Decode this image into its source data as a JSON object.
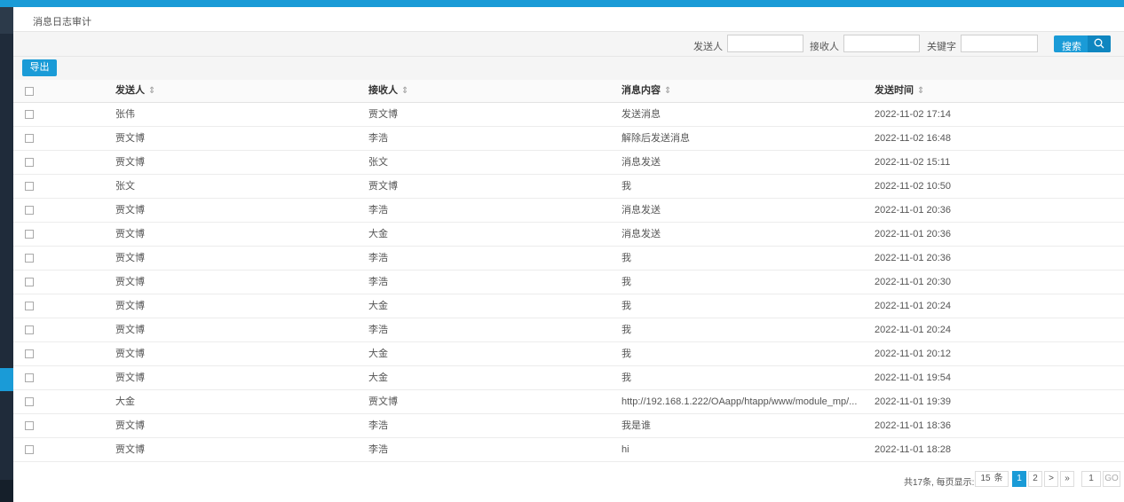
{
  "page": {
    "title": "消息日志审计"
  },
  "search": {
    "sender_label": "发送人",
    "sender_value": "",
    "receiver_label": "接收人",
    "receiver_value": "",
    "keyword_label": "关键字",
    "keyword_value": "",
    "button_label": "搜索"
  },
  "toolbar": {
    "export_label": "导出"
  },
  "table": {
    "columns": [
      "发送人",
      "接收人",
      "消息内容",
      "发送时间"
    ],
    "sort_indicator": "⇕",
    "rows": [
      {
        "sender": "张伟",
        "receiver": "贾文博",
        "content": "发送消息",
        "time": "2022-11-02 17:14"
      },
      {
        "sender": "贾文博",
        "receiver": "李浩",
        "content": "解除后发送消息",
        "time": "2022-11-02 16:48"
      },
      {
        "sender": "贾文博",
        "receiver": "张文",
        "content": "消息发送",
        "time": "2022-11-02 15:11"
      },
      {
        "sender": "张文",
        "receiver": "贾文博",
        "content": "我",
        "time": "2022-11-02 10:50"
      },
      {
        "sender": "贾文博",
        "receiver": "李浩",
        "content": "消息发送",
        "time": "2022-11-01 20:36"
      },
      {
        "sender": "贾文博",
        "receiver": "大金",
        "content": "消息发送",
        "time": "2022-11-01 20:36"
      },
      {
        "sender": "贾文博",
        "receiver": "李浩",
        "content": "我",
        "time": "2022-11-01 20:36"
      },
      {
        "sender": "贾文博",
        "receiver": "李浩",
        "content": "我",
        "time": "2022-11-01 20:30"
      },
      {
        "sender": "贾文博",
        "receiver": "大金",
        "content": "我",
        "time": "2022-11-01 20:24"
      },
      {
        "sender": "贾文博",
        "receiver": "李浩",
        "content": "我",
        "time": "2022-11-01 20:24"
      },
      {
        "sender": "贾文博",
        "receiver": "大金",
        "content": "我",
        "time": "2022-11-01 20:12"
      },
      {
        "sender": "贾文博",
        "receiver": "大金",
        "content": "我",
        "time": "2022-11-01 19:54"
      },
      {
        "sender": "大金",
        "receiver": "贾文博",
        "content": "http://192.168.1.222/OAapp/htapp/www/module_mp/...",
        "time": "2022-11-01 19:39"
      },
      {
        "sender": "贾文博",
        "receiver": "李浩",
        "content": "我是谁",
        "time": "2022-11-01 18:36"
      },
      {
        "sender": "贾文博",
        "receiver": "李浩",
        "content": "hi",
        "time": "2022-11-01 18:28"
      }
    ]
  },
  "pager": {
    "summary": "共17条, 每页显示:",
    "page_size": "15",
    "page_size_unit": "条",
    "pages": [
      "1",
      "2"
    ],
    "current_page": 1,
    "next_label": ">",
    "last_label": "»",
    "jump_value": "1",
    "go_label": "GO"
  },
  "colors": {
    "accent": "#1a9bd7",
    "sidebar": "#1f2b3a"
  }
}
